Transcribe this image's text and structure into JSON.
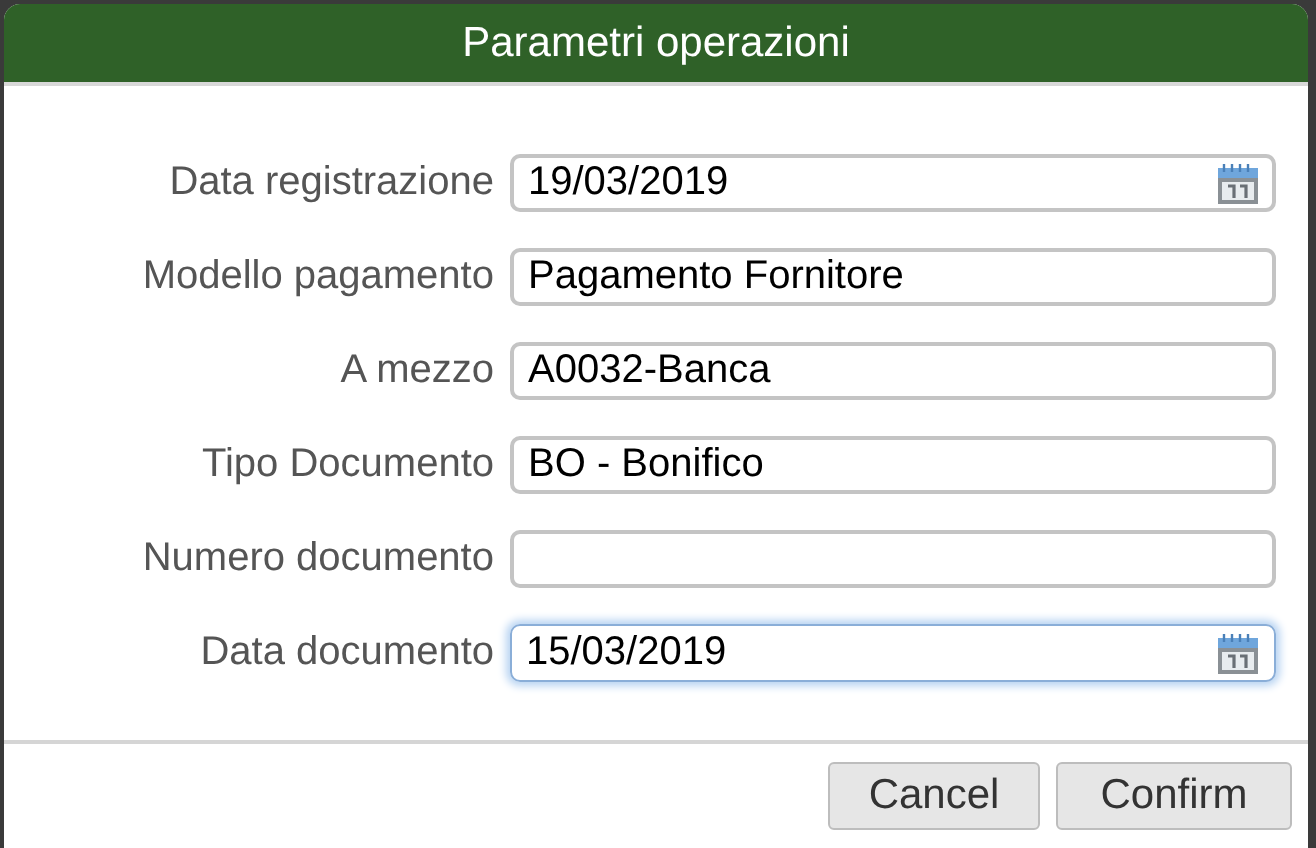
{
  "dialog": {
    "title": "Parametri operazioni"
  },
  "fields": [
    {
      "label": "Data registrazione",
      "value": "19/03/2019",
      "kind": "date",
      "focused": false
    },
    {
      "label": "Modello pagamento",
      "value": "Pagamento Fornitore",
      "kind": "text",
      "focused": false
    },
    {
      "label": "A mezzo",
      "value": "A0032-Banca",
      "kind": "text",
      "focused": false
    },
    {
      "label": "Tipo Documento",
      "value": "BO - Bonifico",
      "kind": "text",
      "focused": false
    },
    {
      "label": "Numero documento",
      "kind": "text",
      "focused": false
    },
    {
      "label": "Data documento",
      "value": "15/03/2019",
      "kind": "date",
      "focused": true
    }
  ],
  "buttons": [
    "Cancel",
    "Confirm"
  ]
}
